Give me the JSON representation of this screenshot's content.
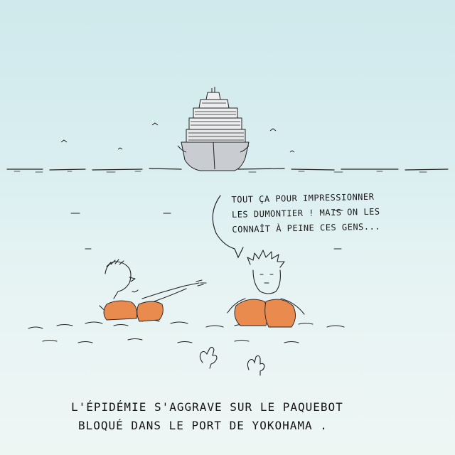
{
  "speech_bubble": {
    "line1": "TOUT ÇA POUR IMPRESSIONNER",
    "line2": "LES DUMONTIER ! MAIS ON LES",
    "line3": "CONNAÎT À PEINE CES GENS..."
  },
  "caption": {
    "line1": "L'ÉPIDÉMIE S'AGGRAVE SUR LE PAQUEBOT",
    "line2": "BLOQUÉ DANS LE PORT DE YOKOHAMA ."
  },
  "colors": {
    "paper": "#d9eef0",
    "ink": "#1a1a1a",
    "life_vest": "#e98a4f",
    "hull": "#c9ccd0"
  },
  "icons": [
    "cruise-ship",
    "seagull",
    "swimmer",
    "life-vest",
    "hand"
  ]
}
